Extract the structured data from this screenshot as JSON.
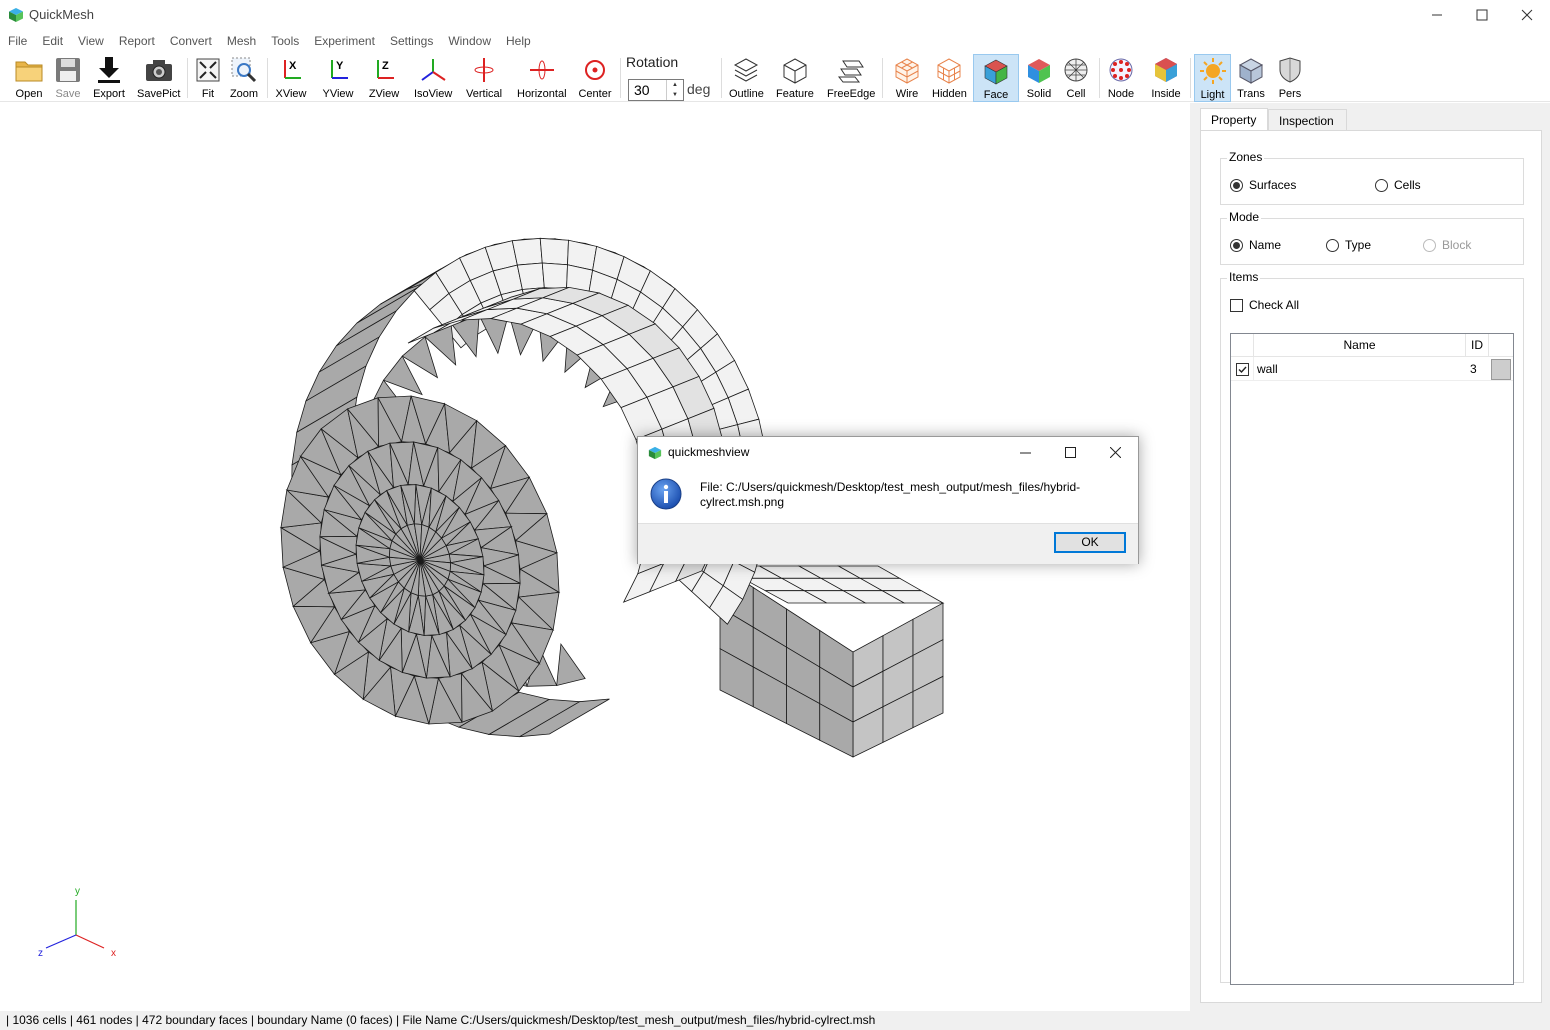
{
  "window": {
    "title": "QuickMesh"
  },
  "menu": [
    "File",
    "Edit",
    "View",
    "Report",
    "Convert",
    "Mesh",
    "Tools",
    "Experiment",
    "Settings",
    "Window",
    "Help"
  ],
  "toolbar": {
    "open": "Open",
    "save": "Save",
    "export": "Export",
    "savepict": "SavePict",
    "fit": "Fit",
    "zoom": "Zoom",
    "xview": "XView",
    "yview": "YView",
    "zview": "ZView",
    "isoview": "IsoView",
    "vertical": "Vertical",
    "horizontal": "Horizontal",
    "center": "Center",
    "rotation_label": "Rotation",
    "rotation_value": "30",
    "rotation_unit": "deg",
    "outline": "Outline",
    "feature": "Feature",
    "freeedge": "FreeEdge",
    "wire": "Wire",
    "hidden": "Hidden",
    "face": "Face",
    "solid": "Solid",
    "cell": "Cell",
    "node": "Node",
    "inside": "Inside",
    "light": "Light",
    "trans": "Trans",
    "pers": "Pers"
  },
  "panel": {
    "tabs": [
      "Property",
      "Inspection"
    ],
    "zones": {
      "title": "Zones",
      "surfaces": "Surfaces",
      "cells": "Cells",
      "selected": "Surfaces"
    },
    "mode": {
      "title": "Mode",
      "name": "Name",
      "type": "Type",
      "block": "Block",
      "selected": "Name"
    },
    "items": {
      "title": "Items",
      "check_all": "Check All",
      "columns": [
        "Name",
        "ID"
      ],
      "rows": [
        {
          "name": "wall",
          "id": "3",
          "checked": true
        }
      ]
    }
  },
  "axes": {
    "x": "x",
    "y": "y",
    "z": "z"
  },
  "statusbar": "| 1036 cells | 461 nodes | 472 boundary faces |  boundary Name  (0 faces) | File Name C:/Users/quickmesh/Desktop/test_mesh_output/mesh_files/hybrid-cylrect.msh",
  "dialog": {
    "title": "quickmeshview",
    "message": "File: C:/Users/quickmesh/Desktop/test_mesh_output/mesh_files/hybrid-cylrect.msh.png",
    "ok": "OK"
  },
  "colors": {
    "accent": "#0078d7",
    "active_tool": "#cce4f7",
    "face_fill": "#a9a9a9",
    "face_light": "#f0f0f0"
  }
}
